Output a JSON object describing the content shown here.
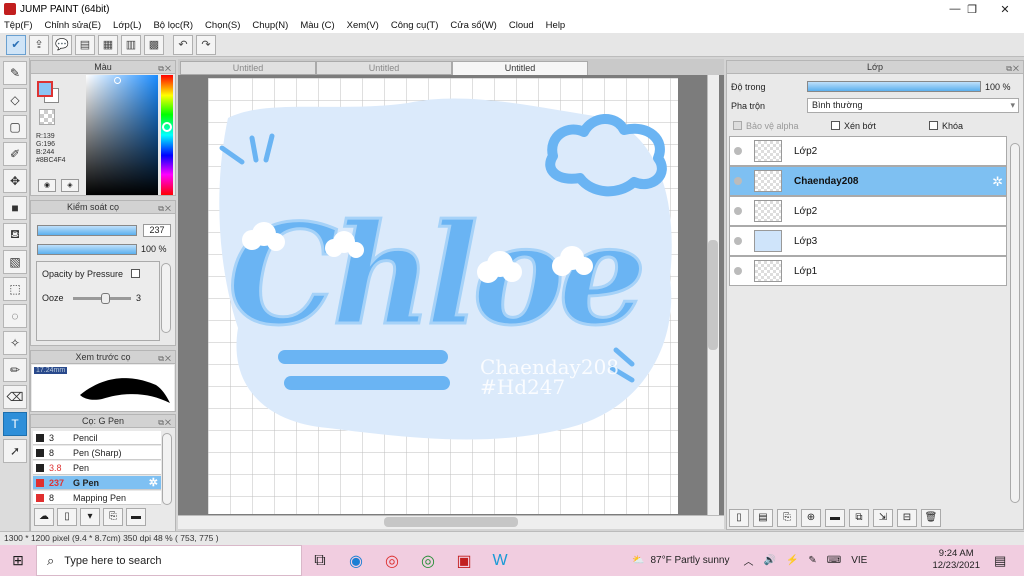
{
  "window": {
    "title": "JUMP PAINT (64bit)"
  },
  "menu": [
    "Tệp(F)",
    "Chỉnh sửa(E)",
    "Lớp(L)",
    "Bộ lọc(R)",
    "Chọn(S)",
    "Chụp(N)",
    "Màu (C)",
    "Xem(V)",
    "Công cụ(T)",
    "Cửa sổ(W)",
    "Cloud",
    "Help"
  ],
  "color_panel": {
    "title": "Màu",
    "r": "R:139",
    "g": "G:196",
    "b": "B:244",
    "hex": "#8BC4F4",
    "fg_color": "#8BC4F4"
  },
  "brush_control": {
    "title": "Kiểm soát cọ",
    "size_value": "237",
    "opacity_value": "100 %",
    "opacity_pressure_label": "Opacity by Pressure",
    "ooze_label": "Ooze",
    "ooze_value": "3"
  },
  "brush_preview": {
    "title": "Xem trước cọ",
    "size_label": "17.24mm"
  },
  "brush_list": {
    "title": "Cọ: G Pen",
    "items": [
      {
        "num": "3",
        "name": "Pencil",
        "color": "#222222"
      },
      {
        "num": "8",
        "name": "Pen (Sharp)",
        "color": "#222222"
      },
      {
        "num": "3.8",
        "name": "Pen",
        "color": "#222222"
      },
      {
        "num": "237",
        "name": "G Pen",
        "color": "#e03030",
        "selected": true
      },
      {
        "num": "8",
        "name": "Mapping Pen",
        "color": "#e03030"
      }
    ]
  },
  "doc_tabs": [
    "Untitled",
    "Untitled",
    "Untitled"
  ],
  "canvas_art": {
    "title_text": "Chloe",
    "watermark_line1": "Chaenday208",
    "watermark_line2": "#Hd247"
  },
  "layer_panel": {
    "title": "Lớp",
    "opacity_label": "Độ trong",
    "opacity_value": "100 %",
    "blend_label": "Pha trộn",
    "blend_value": "Bình thường",
    "protect_alpha": "Bảo vệ alpha",
    "clipping": "Xén bớt",
    "lock": "Khóa",
    "layers": [
      {
        "name": "Lớp2",
        "selected": false
      },
      {
        "name": "Chaenday208",
        "selected": true
      },
      {
        "name": "Lớp2",
        "selected": false
      },
      {
        "name": "Lớp3",
        "selected": false
      },
      {
        "name": "Lớp1",
        "selected": false
      }
    ]
  },
  "status": {
    "text": "1300 * 1200 pixel  (9.4 * 8.7cm)  350 dpi  48 %  ( 753, 775 )"
  },
  "taskbar": {
    "search_placeholder": "Type here to search",
    "weather": "87°F  Partly sunny",
    "lang": "VIE",
    "time": "9:24 AM",
    "date": "12/23/2021"
  }
}
